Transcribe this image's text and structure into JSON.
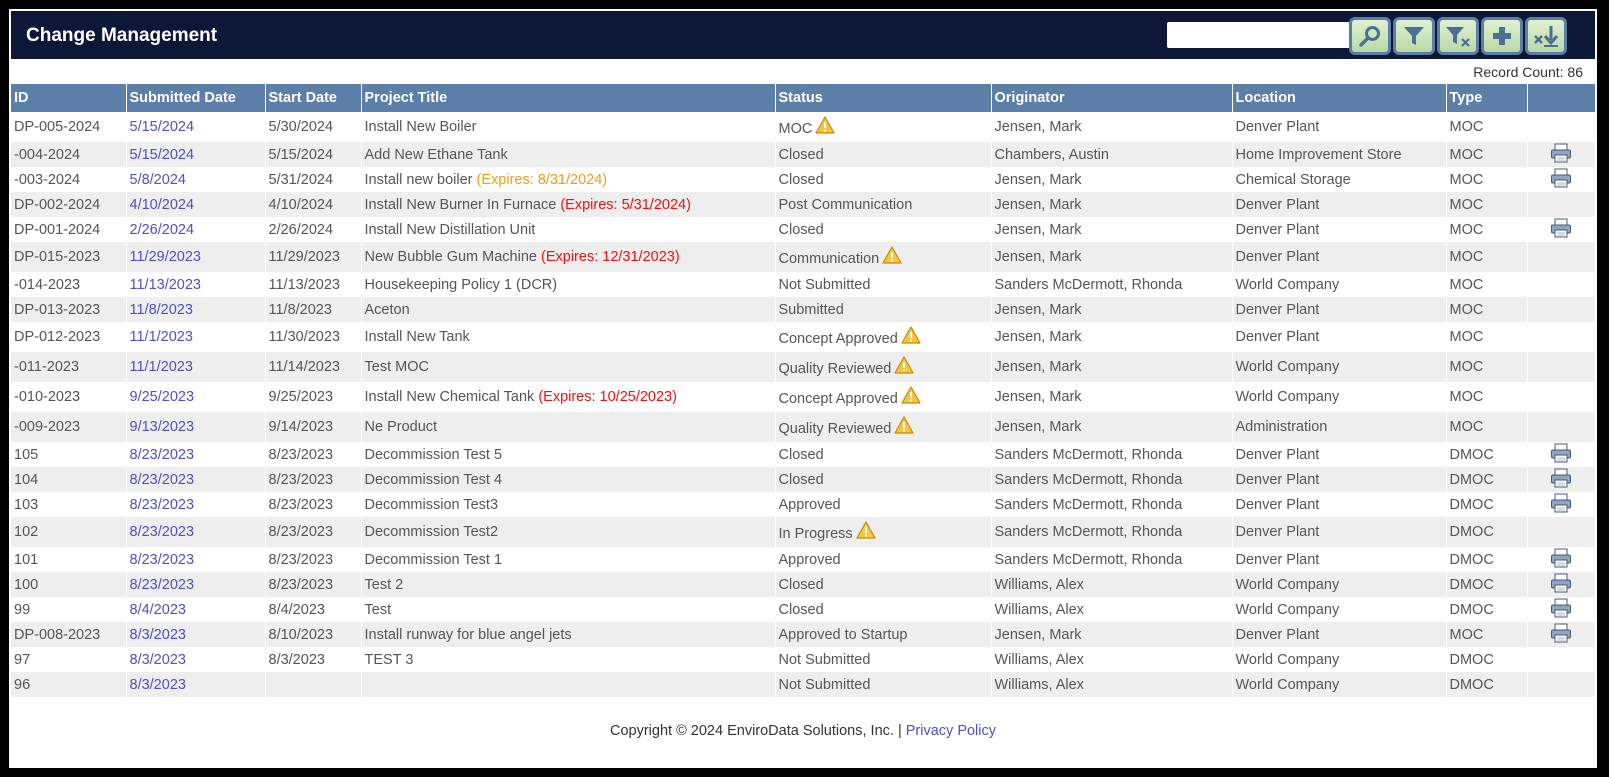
{
  "header": {
    "title": "Change Management",
    "search": {
      "value": "",
      "placeholder": ""
    },
    "toolbar": [
      {
        "name": "search-button",
        "icon": "magnifier-icon"
      },
      {
        "name": "filter-button",
        "icon": "filter-icon"
      },
      {
        "name": "clear-filter-button",
        "icon": "filter-clear-icon"
      },
      {
        "name": "add-button",
        "icon": "plus-icon"
      },
      {
        "name": "export-button",
        "icon": "export-icon"
      }
    ]
  },
  "record_count": "Record Count: 86",
  "table": {
    "columns": [
      "ID",
      "Submitted Date",
      "Start Date",
      "Project Title",
      "Status",
      "Originator",
      "Location",
      "Type",
      ""
    ],
    "rows": [
      {
        "id": "DP-005-2024",
        "submitted": "5/15/2024",
        "start": "5/30/2024",
        "title": "Install New Boiler",
        "expires": "",
        "exp_color": "",
        "status": "MOC",
        "warn": true,
        "originator": "Jensen, Mark",
        "location": "Denver Plant",
        "type": "MOC",
        "print": false
      },
      {
        "id": "-004-2024",
        "submitted": "5/15/2024",
        "start": "5/15/2024",
        "title": "Add New Ethane Tank",
        "expires": "",
        "exp_color": "",
        "status": "Closed",
        "warn": false,
        "originator": "Chambers, Austin",
        "location": "Home Improvement Store",
        "type": "MOC",
        "print": true
      },
      {
        "id": "-003-2024",
        "submitted": "5/8/2024",
        "start": "5/31/2024",
        "title": "Install new boiler",
        "expires": "(Expires: 8/31/2024)",
        "exp_color": "orange",
        "status": "Closed",
        "warn": false,
        "originator": "Jensen, Mark",
        "location": "Chemical Storage",
        "type": "MOC",
        "print": true
      },
      {
        "id": "DP-002-2024",
        "submitted": "4/10/2024",
        "start": "4/10/2024",
        "title": "Install New Burner In Furnace",
        "expires": "(Expires: 5/31/2024)",
        "exp_color": "red",
        "status": "Post Communication",
        "warn": false,
        "originator": "Jensen, Mark",
        "location": "Denver Plant",
        "type": "MOC",
        "print": false
      },
      {
        "id": "DP-001-2024",
        "submitted": "2/26/2024",
        "start": "2/26/2024",
        "title": "Install New Distillation Unit",
        "expires": "",
        "exp_color": "",
        "status": "Closed",
        "warn": false,
        "originator": "Jensen, Mark",
        "location": "Denver Plant",
        "type": "MOC",
        "print": true
      },
      {
        "id": "DP-015-2023",
        "submitted": "11/29/2023",
        "start": "11/29/2023",
        "title": "New Bubble Gum Machine",
        "expires": "(Expires: 12/31/2023)",
        "exp_color": "red",
        "status": "Communication",
        "warn": true,
        "originator": "Jensen, Mark",
        "location": "Denver Plant",
        "type": "MOC",
        "print": false
      },
      {
        "id": "-014-2023",
        "submitted": "11/13/2023",
        "start": "11/13/2023",
        "title": "Housekeeping Policy 1 (DCR)",
        "expires": "",
        "exp_color": "",
        "status": "Not Submitted",
        "warn": false,
        "originator": "Sanders McDermott, Rhonda",
        "location": "World Company",
        "type": "MOC",
        "print": false
      },
      {
        "id": "DP-013-2023",
        "submitted": "11/8/2023",
        "start": "11/8/2023",
        "title": "Aceton",
        "expires": "",
        "exp_color": "",
        "status": "Submitted",
        "warn": false,
        "originator": "Jensen, Mark",
        "location": "Denver Plant",
        "type": "MOC",
        "print": false
      },
      {
        "id": "DP-012-2023",
        "submitted": "11/1/2023",
        "start": "11/30/2023",
        "title": "Install New Tank",
        "expires": "",
        "exp_color": "",
        "status": "Concept Approved",
        "warn": true,
        "originator": "Jensen, Mark",
        "location": "Denver Plant",
        "type": "MOC",
        "print": false
      },
      {
        "id": "-011-2023",
        "submitted": "11/1/2023",
        "start": "11/14/2023",
        "title": "Test MOC",
        "expires": "",
        "exp_color": "",
        "status": "Quality Reviewed",
        "warn": true,
        "originator": "Jensen, Mark",
        "location": "World Company",
        "type": "MOC",
        "print": false
      },
      {
        "id": "-010-2023",
        "submitted": "9/25/2023",
        "start": "9/25/2023",
        "title": "Install New Chemical Tank",
        "expires": "(Expires: 10/25/2023)",
        "exp_color": "red",
        "status": "Concept Approved",
        "warn": true,
        "originator": "Jensen, Mark",
        "location": "World Company",
        "type": "MOC",
        "print": false
      },
      {
        "id": "-009-2023",
        "submitted": "9/13/2023",
        "start": "9/14/2023",
        "title": "Ne Product",
        "expires": "",
        "exp_color": "",
        "status": "Quality Reviewed",
        "warn": true,
        "originator": "Jensen, Mark",
        "location": "Administration",
        "type": "MOC",
        "print": false
      },
      {
        "id": "105",
        "submitted": "8/23/2023",
        "start": "8/23/2023",
        "title": "Decommission Test 5",
        "expires": "",
        "exp_color": "",
        "status": "Closed",
        "warn": false,
        "originator": "Sanders McDermott, Rhonda",
        "location": "Denver Plant",
        "type": "DMOC",
        "print": true
      },
      {
        "id": "104",
        "submitted": "8/23/2023",
        "start": "8/23/2023",
        "title": "Decommission Test 4",
        "expires": "",
        "exp_color": "",
        "status": "Closed",
        "warn": false,
        "originator": "Sanders McDermott, Rhonda",
        "location": "Denver Plant",
        "type": "DMOC",
        "print": true
      },
      {
        "id": "103",
        "submitted": "8/23/2023",
        "start": "8/23/2023",
        "title": "Decommission Test3",
        "expires": "",
        "exp_color": "",
        "status": "Approved",
        "warn": false,
        "originator": "Sanders McDermott, Rhonda",
        "location": "Denver Plant",
        "type": "DMOC",
        "print": true
      },
      {
        "id": "102",
        "submitted": "8/23/2023",
        "start": "8/23/2023",
        "title": "Decommission Test2",
        "expires": "",
        "exp_color": "",
        "status": "In Progress",
        "warn": true,
        "originator": "Sanders McDermott, Rhonda",
        "location": "Denver Plant",
        "type": "DMOC",
        "print": false
      },
      {
        "id": "101",
        "submitted": "8/23/2023",
        "start": "8/23/2023",
        "title": "Decommission Test 1",
        "expires": "",
        "exp_color": "",
        "status": "Approved",
        "warn": false,
        "originator": "Sanders McDermott, Rhonda",
        "location": "Denver Plant",
        "type": "DMOC",
        "print": true
      },
      {
        "id": "100",
        "submitted": "8/23/2023",
        "start": "8/23/2023",
        "title": "Test 2",
        "expires": "",
        "exp_color": "",
        "status": "Closed",
        "warn": false,
        "originator": "Williams, Alex",
        "location": "World Company",
        "type": "DMOC",
        "print": true
      },
      {
        "id": "99",
        "submitted": "8/4/2023",
        "start": "8/4/2023",
        "title": "Test",
        "expires": "",
        "exp_color": "",
        "status": "Closed",
        "warn": false,
        "originator": "Williams, Alex",
        "location": "World Company",
        "type": "DMOC",
        "print": true
      },
      {
        "id": "DP-008-2023",
        "submitted": "8/3/2023",
        "start": "8/10/2023",
        "title": "Install runway for blue angel jets",
        "expires": "",
        "exp_color": "",
        "status": "Approved to Startup",
        "warn": false,
        "originator": "Jensen, Mark",
        "location": "Denver Plant",
        "type": "MOC",
        "print": true
      },
      {
        "id": "97",
        "submitted": "8/3/2023",
        "start": "8/3/2023",
        "title": "TEST 3",
        "expires": "",
        "exp_color": "",
        "status": "Not Submitted",
        "warn": false,
        "originator": "Williams, Alex",
        "location": "World Company",
        "type": "DMOC",
        "print": false
      },
      {
        "id": "96",
        "submitted": "8/3/2023",
        "start": "",
        "title": "",
        "expires": "",
        "exp_color": "",
        "status": "Not Submitted",
        "warn": false,
        "originator": "Williams, Alex",
        "location": "World Company",
        "type": "DMOC",
        "print": false
      }
    ]
  },
  "footer": {
    "copyright": "Copyright © 2024 EnviroData Solutions, Inc. |",
    "privacy_link": "Privacy Policy"
  },
  "colors": {
    "header_bg": "#0d1838",
    "table_header_bg": "#5b7fa8",
    "link": "#4f4fc6",
    "expires_orange": "#f39c12",
    "expires_red": "#ee1111",
    "warning": "#f4c542"
  }
}
